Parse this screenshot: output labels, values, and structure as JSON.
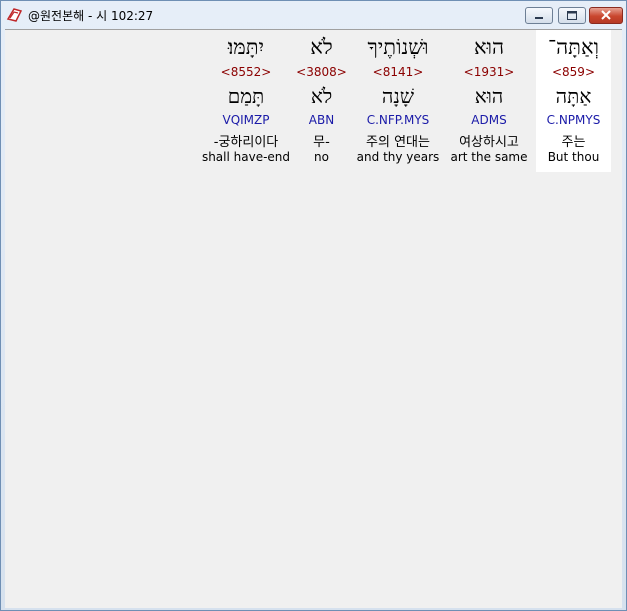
{
  "window": {
    "title": "@원전본해 - 시 102:27",
    "icon": "app-icon"
  },
  "columns": [
    {
      "hebrew": "וְאַתָּה־",
      "strongs": "<859>",
      "lemma": "אַתָּה",
      "morph": "C.NPMYS",
      "korean": "주는",
      "english": "But thou",
      "selected": true
    },
    {
      "hebrew": "הוּא",
      "strongs": "<1931>",
      "lemma": "הוּא",
      "morph": "ADMS",
      "korean": "여상하시고",
      "english": "art the same",
      "selected": false
    },
    {
      "hebrew": "וּשְׁנוֹתֶיךָ",
      "strongs": "<8141>",
      "lemma": "שָׁנָה",
      "morph": "C.NFP.MYS",
      "korean": "주의 연대는",
      "english": "and thy years",
      "selected": false
    },
    {
      "hebrew": "לֹא",
      "strongs": "<3808>",
      "lemma": "לֹא",
      "morph": "ABN",
      "korean": "무-",
      "english": "no",
      "selected": false
    },
    {
      "hebrew": "יִתָּמּוּ׃",
      "strongs": "<8552>",
      "lemma": "תָּמַם",
      "morph": "VQIMZP",
      "korean": "-궁하리이다",
      "english": "shall have-end",
      "selected": false
    }
  ]
}
